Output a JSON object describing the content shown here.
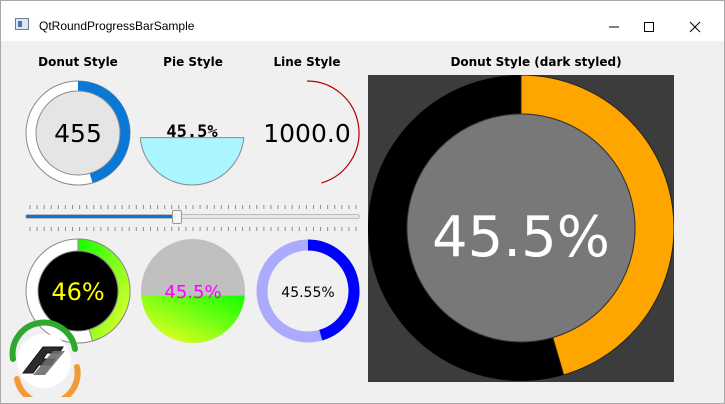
{
  "window": {
    "title": "QtRoundProgressBarSample",
    "controls": [
      "minimize",
      "maximize",
      "close"
    ]
  },
  "labels": {
    "donut": "Donut Style",
    "pie": "Pie Style",
    "line": "Line Style",
    "dark": "Donut Style (dark styled)"
  },
  "bars": {
    "donut_value": "455",
    "pie_value": "45.5%",
    "line_value": "1000.0",
    "gradient_donut_value": "46%",
    "gradient_pie_value": "45.5%",
    "blue_donut_value": "45.55%",
    "dark_donut_value": "45.5%"
  },
  "slider": {
    "progress": 0.455
  },
  "colors": {
    "donut_blue": "#0a78d7",
    "pie_fill": "#aaf5ff",
    "line_red": "#b40000",
    "gradient_text_yellow": "#ffff00",
    "gradient_pie_text": "#ff00ff",
    "blue_ring": "#0000ff",
    "blue_ring_track": "#aaaaff",
    "dark_orange": "#ffa500",
    "dark_black": "#000000",
    "dark_inner": "#787878"
  },
  "icons": {
    "logo": "qt-round-progress-logo-icon"
  }
}
